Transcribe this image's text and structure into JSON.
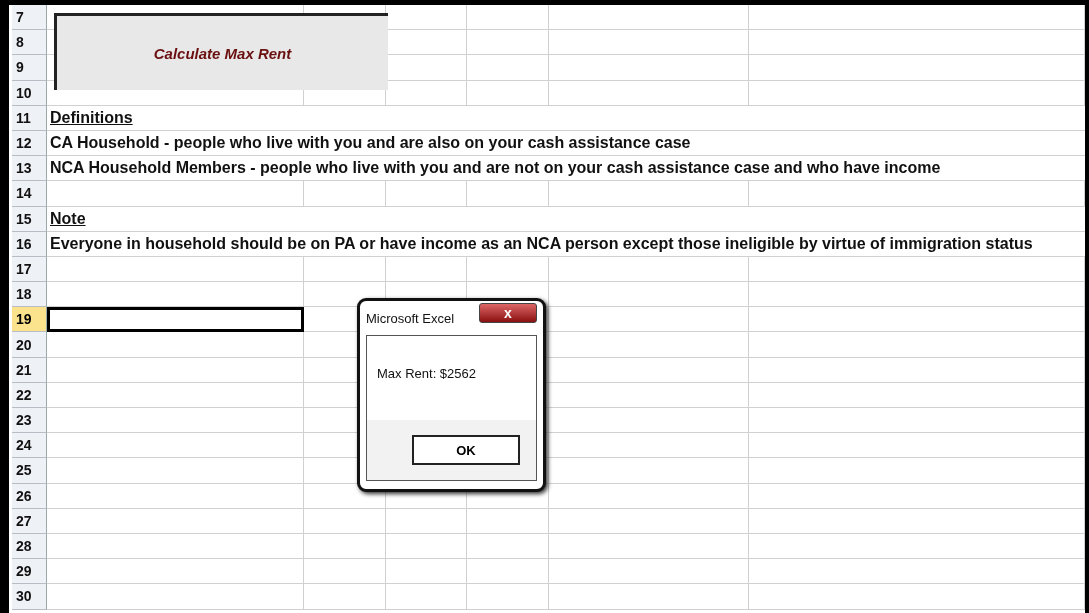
{
  "macro_button": {
    "label": "Calculate Max Rent"
  },
  "rows": [
    {
      "number": "7",
      "selected": false
    },
    {
      "number": "8",
      "selected": false
    },
    {
      "number": "9",
      "selected": false
    },
    {
      "number": "10",
      "selected": false
    },
    {
      "number": "11",
      "selected": false,
      "kind": "heading",
      "text": "Definitions"
    },
    {
      "number": "12",
      "selected": false,
      "kind": "text",
      "text": "CA Household - people who live with you and are also on your cash assistance case"
    },
    {
      "number": "13",
      "selected": false,
      "kind": "text",
      "text": "NCA Household Members - people who live with you and are not on your cash assistance case and who have income"
    },
    {
      "number": "14",
      "selected": false
    },
    {
      "number": "15",
      "selected": false,
      "kind": "heading",
      "text": "Note"
    },
    {
      "number": "16",
      "selected": false,
      "kind": "text",
      "text": "Everyone in household should be on PA or have income as an NCA person except those ineligible by virtue of immigration status"
    },
    {
      "number": "17",
      "selected": false
    },
    {
      "number": "18",
      "selected": false
    },
    {
      "number": "19",
      "selected": true
    },
    {
      "number": "20",
      "selected": false
    },
    {
      "number": "21",
      "selected": false
    },
    {
      "number": "22",
      "selected": false
    },
    {
      "number": "23",
      "selected": false
    },
    {
      "number": "24",
      "selected": false
    },
    {
      "number": "25",
      "selected": false
    },
    {
      "number": "26",
      "selected": false
    },
    {
      "number": "27",
      "selected": false
    },
    {
      "number": "28",
      "selected": false
    },
    {
      "number": "29",
      "selected": false
    },
    {
      "number": "30",
      "selected": false
    }
  ],
  "dialog": {
    "title": "Microsoft Excel",
    "close": "x",
    "message": "Max Rent: $2562",
    "buttons": [
      "OK"
    ]
  }
}
